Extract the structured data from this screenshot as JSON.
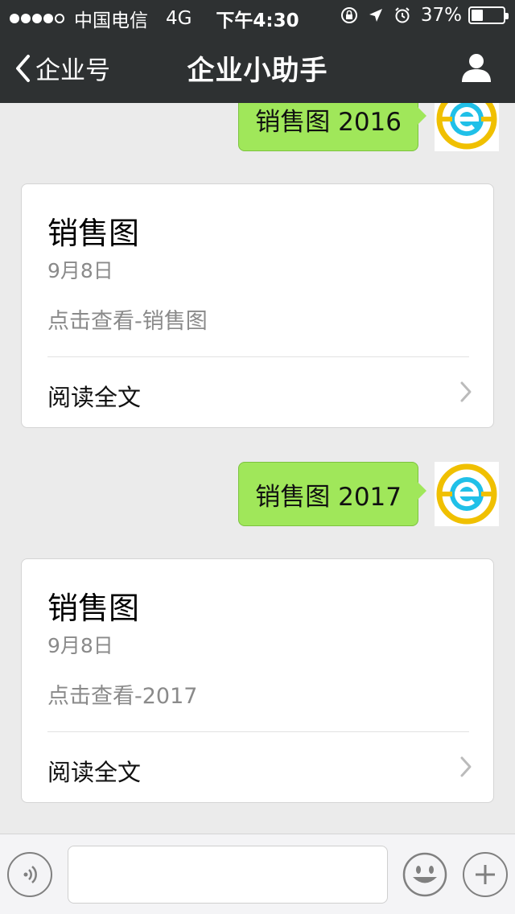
{
  "status_bar": {
    "carrier": "中国电信",
    "network": "4G",
    "time": "下午4:30",
    "battery_text": "37%",
    "battery_level": 0.37,
    "signal_bars_filled": 4,
    "signal_bars_total": 5
  },
  "nav": {
    "back_label": "企业号",
    "title": "企业小助手",
    "profile_icon": "person-icon"
  },
  "messages": [
    {
      "type": "outgoing",
      "text": "销售图 2016"
    },
    {
      "type": "card",
      "title": "销售图",
      "date": "9月8日",
      "desc": "点击查看-销售图",
      "action": "阅读全文"
    },
    {
      "type": "outgoing",
      "text": "销售图 2017"
    },
    {
      "type": "card",
      "title": "销售图",
      "date": "9月8日",
      "desc": "点击查看-2017",
      "action": "阅读全文"
    }
  ],
  "input_bar": {
    "value": "",
    "voice_icon": "voice-icon",
    "emoji_icon": "emoji-icon",
    "plus_icon": "plus-icon"
  },
  "colors": {
    "nav_bg": "#2e3132",
    "bubble_green": "#a0e75a",
    "chat_bg": "#ebebeb",
    "avatar_yellow": "#f0c000",
    "avatar_blue": "#20c0e8"
  }
}
